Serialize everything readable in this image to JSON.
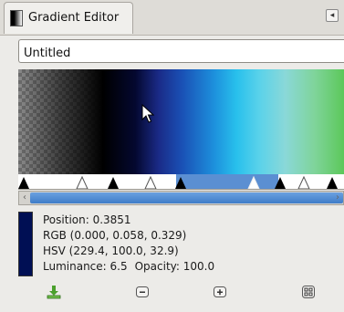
{
  "tab": {
    "label": "Gradient Editor",
    "icon": "gradient-icon",
    "menu_icon": "tab-menu-icon"
  },
  "gradient_name": {
    "value": "Untitled"
  },
  "preview": {
    "cursor_icon": "mouse-pointer-icon"
  },
  "info": {
    "color": "#000f54",
    "position": "Position: 0.3851",
    "rgb": "RGB (0.000, 0.058, 0.329)",
    "hsv": "HSV (229.4, 100.0, 32.9)",
    "luminance": "Luminance: 6.5",
    "opacity": "Opacity: 100.0"
  },
  "scrollbar": {
    "left_arrow": "‹",
    "right_arrow": "›"
  },
  "toolbar": {
    "buttons": [
      {
        "name": "save-icon"
      },
      {
        "name": "zoom-out-icon"
      },
      {
        "name": "zoom-in-icon"
      },
      {
        "name": "zoom-all-icon"
      }
    ]
  }
}
